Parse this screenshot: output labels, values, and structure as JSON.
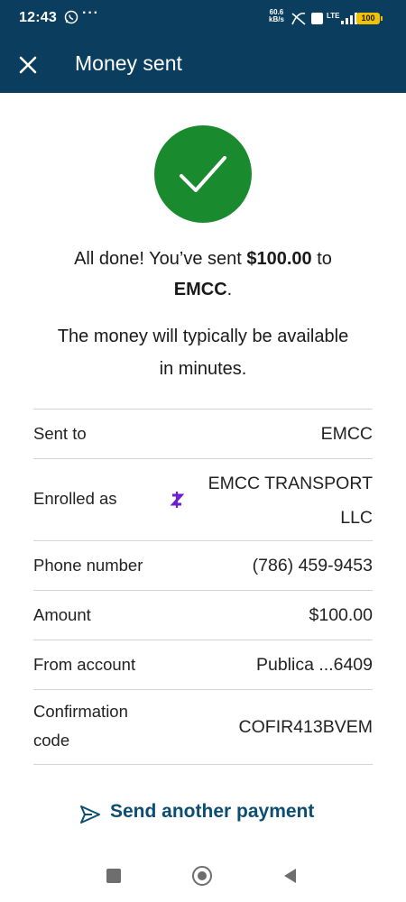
{
  "status_bar": {
    "time": "12:43",
    "more": "···",
    "net_speed_value": "60.6",
    "net_speed_unit": "kB/s",
    "network": "LTE",
    "battery": "100"
  },
  "header": {
    "title": "Money sent",
    "close_icon": "close-icon"
  },
  "confirmation": {
    "done_prefix": "All done! You’ve sent ",
    "amount": "$100.00",
    "done_middle": " to",
    "recipient": "EMCC",
    "done_suffix": ".",
    "availability": "The money will typically be available in minutes."
  },
  "details": {
    "sent_to_label": "Sent to",
    "sent_to_value": "EMCC",
    "enrolled_label": "Enrolled as",
    "enrolled_value": "EMCC TRANSPORT LLC",
    "phone_label": "Phone number",
    "phone_value": "(786) 459-9453",
    "amount_label": "Amount",
    "amount_value": "$100.00",
    "from_label": "From account",
    "from_value": "Publica ...6409",
    "confirmation_label": "Confirmation code",
    "confirmation_value": "COFIR413BVEM"
  },
  "actions": {
    "send_another": "Send another payment"
  },
  "colors": {
    "header_bg": "#0b3e5e",
    "success_green": "#198a2d",
    "link_blue": "#0b4e72",
    "zelle_purple": "#6d1ed4"
  }
}
